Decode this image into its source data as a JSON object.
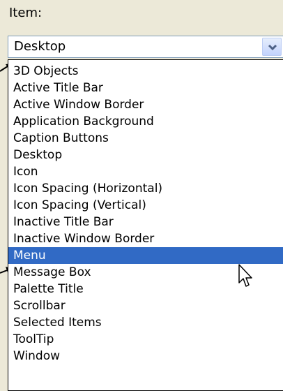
{
  "field_label": "Item:",
  "combo": {
    "value": "Desktop",
    "button_icon": "chevron-down-icon"
  },
  "list": {
    "items": [
      "3D Objects",
      "Active Title Bar",
      "Active Window Border",
      "Application Background",
      "Caption Buttons",
      "Desktop",
      "Icon",
      "Icon Spacing (Horizontal)",
      "Icon Spacing (Vertical)",
      "Inactive Title Bar",
      "Inactive Window Border",
      "Menu",
      "Message Box",
      "Palette Title",
      "Scrollbar",
      "Selected Items",
      "ToolTip",
      "Window"
    ],
    "selected_index": 11
  },
  "colors": {
    "dialog_background": "#ece9d8",
    "selection_background": "#316ac5",
    "selection_text": "#ffffff",
    "combo_border": "#7f9db9",
    "button_arrow": "#4d6185"
  },
  "icons": {
    "callout_arrows": "arrow-right-icon",
    "cursor": "mouse-pointer-icon"
  }
}
